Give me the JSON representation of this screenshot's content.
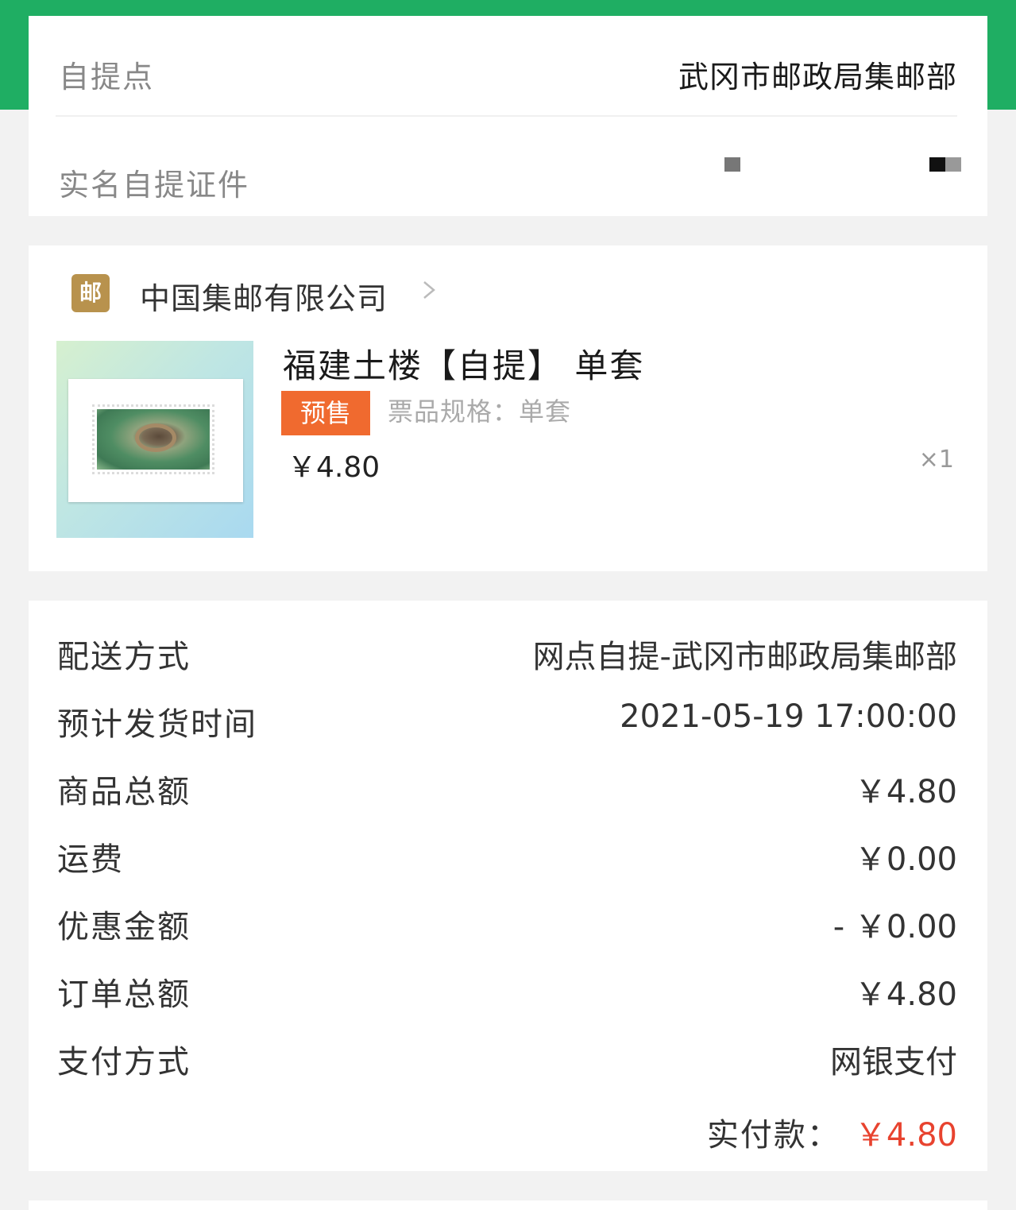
{
  "pickup": {
    "point_label": "自提点",
    "point_value": "武冈市邮政局集邮部",
    "id_label": "实名自提证件"
  },
  "shop": {
    "logo_text": "邮",
    "name": "中国集邮有限公司"
  },
  "product": {
    "title": "福建土楼【自提】 单套",
    "tag": "预售",
    "spec": "票品规格：单套",
    "price": "￥4.80",
    "qty": "×1"
  },
  "details": {
    "rows": [
      {
        "label": "配送方式",
        "value": "网点自提-武冈市邮政局集邮部"
      },
      {
        "label": "预计发货时间",
        "value": "2021-05-19 17:00:00"
      },
      {
        "label": "商品总额",
        "value": "￥4.80"
      },
      {
        "label": "运费",
        "value": "￥0.00"
      },
      {
        "label": "优惠金额",
        "value": "- ￥0.00"
      },
      {
        "label": "订单总额",
        "value": "￥4.80"
      },
      {
        "label": "支付方式",
        "value": "网银支付"
      }
    ],
    "paid_label": "实付款：",
    "paid_amount": "￥4.80"
  },
  "colors": {
    "header_green": "#1fae63",
    "presale_orange": "#f06a2f",
    "paid_red": "#e8432f",
    "logo_gold": "#b8924d"
  }
}
